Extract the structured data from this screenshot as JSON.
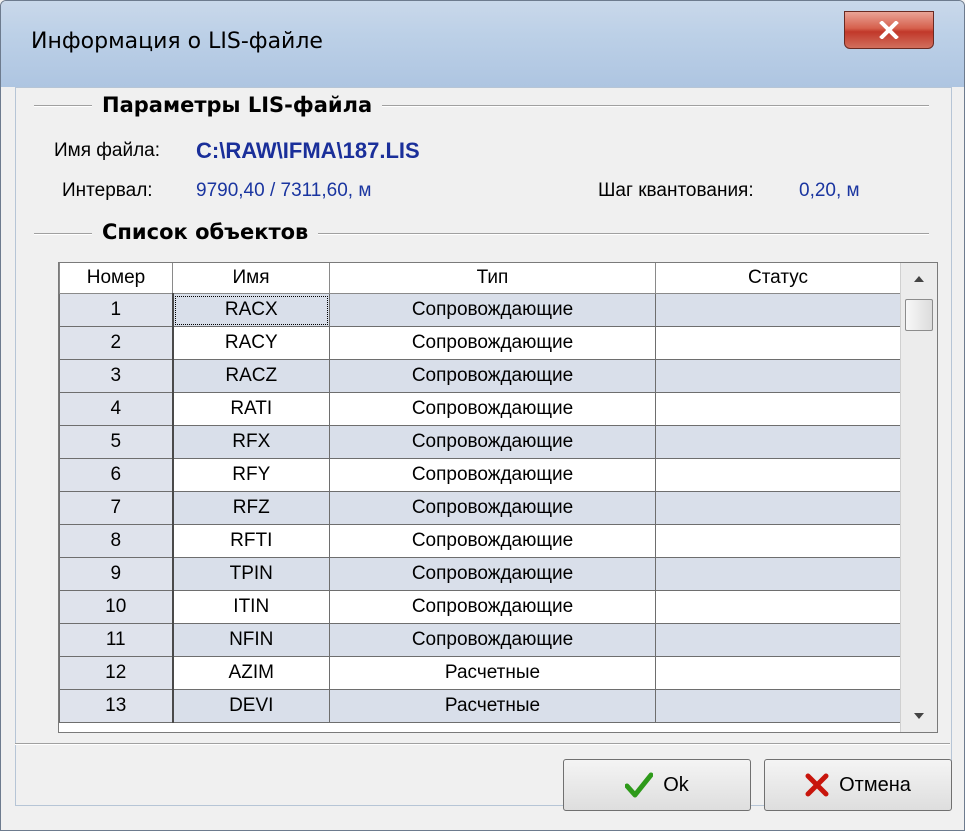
{
  "window": {
    "title": "Информация о LIS-файле"
  },
  "params": {
    "group_title": "Параметры LIS-файла",
    "filename_label": "Имя файла:",
    "filename_value": "C:\\RAW\\IFMA\\187.LIS",
    "interval_label": "Интервал:",
    "interval_value": "9790,40 / 7311,60, м",
    "step_label": "Шаг квантования:",
    "step_value": "0,20, м"
  },
  "objects": {
    "group_title": "Список объектов",
    "columns": [
      "Номер",
      "Имя",
      "Тип",
      "Статус"
    ],
    "rows": [
      {
        "num": "1",
        "name": "RACX",
        "type": "Сопровождающие",
        "status": ""
      },
      {
        "num": "2",
        "name": "RACY",
        "type": "Сопровождающие",
        "status": ""
      },
      {
        "num": "3",
        "name": "RACZ",
        "type": "Сопровождающие",
        "status": ""
      },
      {
        "num": "4",
        "name": "RATI",
        "type": "Сопровождающие",
        "status": ""
      },
      {
        "num": "5",
        "name": "RFX",
        "type": "Сопровождающие",
        "status": ""
      },
      {
        "num": "6",
        "name": "RFY",
        "type": "Сопровождающие",
        "status": ""
      },
      {
        "num": "7",
        "name": "RFZ",
        "type": "Сопровождающие",
        "status": ""
      },
      {
        "num": "8",
        "name": "RFTI",
        "type": "Сопровождающие",
        "status": ""
      },
      {
        "num": "9",
        "name": "TPIN",
        "type": "Сопровождающие",
        "status": ""
      },
      {
        "num": "10",
        "name": "ITIN",
        "type": "Сопровождающие",
        "status": ""
      },
      {
        "num": "11",
        "name": "NFIN",
        "type": "Сопровождающие",
        "status": ""
      },
      {
        "num": "12",
        "name": "AZIM",
        "type": "Расчетные",
        "status": ""
      },
      {
        "num": "13",
        "name": "DEVI",
        "type": "Расчетные",
        "status": ""
      }
    ]
  },
  "buttons": {
    "ok_label": "Ok",
    "cancel_label": "Отмена"
  },
  "icons": {
    "close": "close-icon",
    "ok": "checkmark-icon",
    "cancel": "cross-icon"
  },
  "colors": {
    "value_text": "#1a35a0",
    "ok_icon": "#2e9a1a",
    "cancel_icon": "#c8150c",
    "titlebar": "#bcd0e7"
  }
}
